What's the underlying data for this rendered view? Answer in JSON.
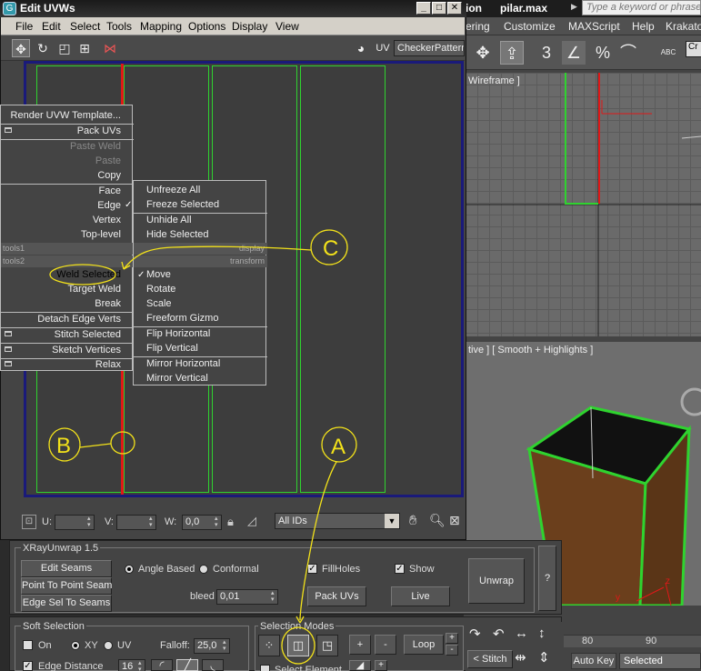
{
  "max": {
    "title_left": "ion",
    "title_file": "pilar.max",
    "search_placeholder": "Type a keyword or phrase",
    "menus": [
      "ering",
      "Customize",
      "MAXScript",
      "Help",
      "Krakato"
    ],
    "toolbar_num": "3",
    "toolbar_pct": "%",
    "toolbar_cr": "Cr",
    "toolbar_abc": "ABC",
    "viewport_top_label": "Wireframe ]",
    "viewport_persp_label": "tive ] [ Smooth + Highlights ]",
    "ruler_80": "80",
    "ruler_90": "90",
    "autokey": "Auto Key",
    "selected": "Selected",
    "axis_x": "x",
    "axis_y": "y",
    "axis_z": "z"
  },
  "uvw": {
    "title": "Edit UVWs",
    "title_icon": "G",
    "menus": [
      "File",
      "Edit",
      "Select",
      "Tools",
      "Mapping",
      "Options",
      "Display",
      "View"
    ],
    "uv_label": "UV",
    "checker": "CheckerPattern",
    "u_label": "U:",
    "v_label": "V:",
    "w_label": "W:",
    "w_value": "0,0",
    "ids": "All IDs"
  },
  "quad_left": {
    "render_template": "Render UVW Template...",
    "pack_uvs": "Pack UVs",
    "paste_weld": "Paste Weld",
    "paste": "Paste",
    "copy": "Copy",
    "face": "Face",
    "edge": "Edge",
    "vertex": "Vertex",
    "top_level": "Top-level",
    "tools1": "tools1",
    "tools2": "tools2",
    "weld_selected": "Weld Selected",
    "target_weld": "Target Weld",
    "break": "Break",
    "detach_edge_verts": "Detach Edge Verts",
    "stitch_selected": "Stitch Selected",
    "sketch_vertices": "Sketch Vertices",
    "relax": "Relax"
  },
  "quad_right": {
    "unfreeze_all": "Unfreeze All",
    "freeze_selected": "Freeze Selected",
    "unhide_all": "Unhide All",
    "hide_selected": "Hide Selected",
    "display": "display",
    "transform": "transform",
    "move": "Move",
    "rotate": "Rotate",
    "scale": "Scale",
    "freeform_gizmo": "Freeform Gizmo",
    "flip_horizontal": "Flip Horizontal",
    "flip_vertical": "Flip Vertical",
    "mirror_horizontal": "Mirror Horizontal",
    "mirror_vertical": "Mirror Vertical"
  },
  "xray": {
    "title": "XRayUnwrap 1.5",
    "edit_seams": "Edit Seams",
    "point_to_point": "Point To Point Seam",
    "edge_sel_to_seams": "Edge Sel To Seams",
    "angle_based": "Angle Based",
    "conformal": "Conformal",
    "bleed_label": "bleed",
    "bleed_value": "0,01",
    "fillholes": "FillHoles",
    "show": "Show",
    "pack_uvs": "Pack UVs",
    "live": "Live",
    "unwrap": "Unwrap",
    "help": "?"
  },
  "soft": {
    "title": "Soft Selection",
    "on": "On",
    "xy": "XY",
    "uv": "UV",
    "falloff_label": "Falloff:",
    "falloff_value": "25,0",
    "edge_distance": "Edge Distance",
    "edge_distance_value": "16"
  },
  "selmodes": {
    "title": "Selection Modes",
    "plus": "+",
    "minus": "-",
    "loop": "Loop",
    "stitch": "Stitch",
    "select_element": "Select Element"
  },
  "annotations": {
    "a": "A",
    "b": "B",
    "c": "C"
  },
  "colors": {
    "uv_edge": "#2fd32f",
    "selected_edge": "#e01818",
    "annotation": "#f3e21a",
    "canvas_border": "#1a1a7a"
  }
}
